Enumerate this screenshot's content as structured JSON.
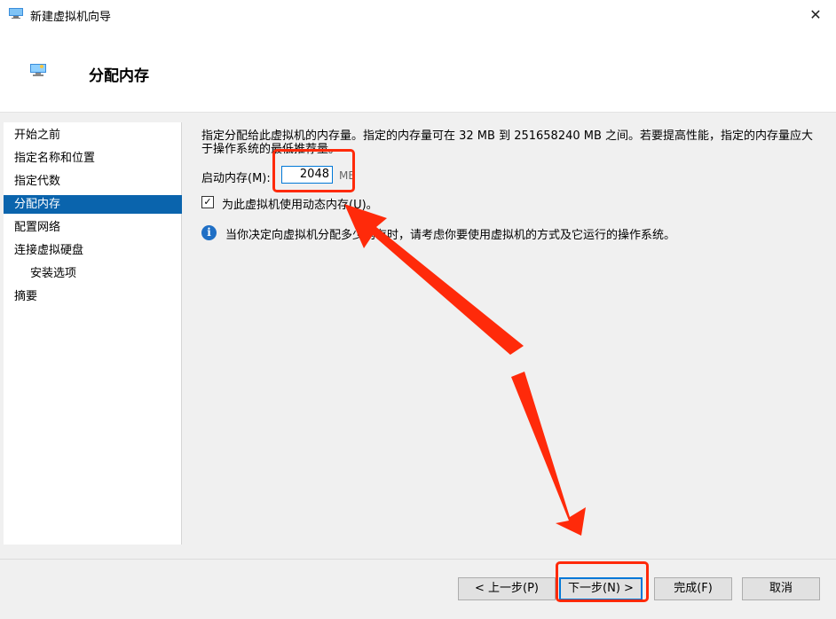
{
  "window": {
    "title": "新建虚拟机向导",
    "close_glyph": "✕"
  },
  "header": {
    "title": "分配内存"
  },
  "nav": {
    "items": [
      {
        "label": "开始之前"
      },
      {
        "label": "指定名称和位置"
      },
      {
        "label": "指定代数"
      },
      {
        "label": "分配内存"
      },
      {
        "label": "配置网络"
      },
      {
        "label": "连接虚拟硬盘"
      },
      {
        "label": "安装选项"
      },
      {
        "label": "摘要"
      }
    ]
  },
  "content": {
    "description": "指定分配给此虚拟机的内存量。指定的内存量可在 32 MB 到 251658240 MB 之间。若要提高性能，指定的内存量应大于操作系统的最低推荐量。",
    "startup_memory_label": "启动内存(M):",
    "startup_memory_value": "2048",
    "memory_unit": "MB",
    "dynamic_memory_checked": true,
    "dynamic_memory_label": "为此虚拟机使用动态内存(U)。",
    "info_glyph": "i",
    "info_text": "当你决定向虚拟机分配多少内存时，请考虑你要使用虚拟机的方式及它运行的操作系统。"
  },
  "footer": {
    "prev_label": "< 上一步(P)",
    "next_label": "下一步(N) >",
    "finish_label": "完成(F)",
    "cancel_label": "取消"
  },
  "colors": {
    "accent": "#0a64ad",
    "annotation": "#ff2a0a",
    "info": "#1f6fc5"
  }
}
